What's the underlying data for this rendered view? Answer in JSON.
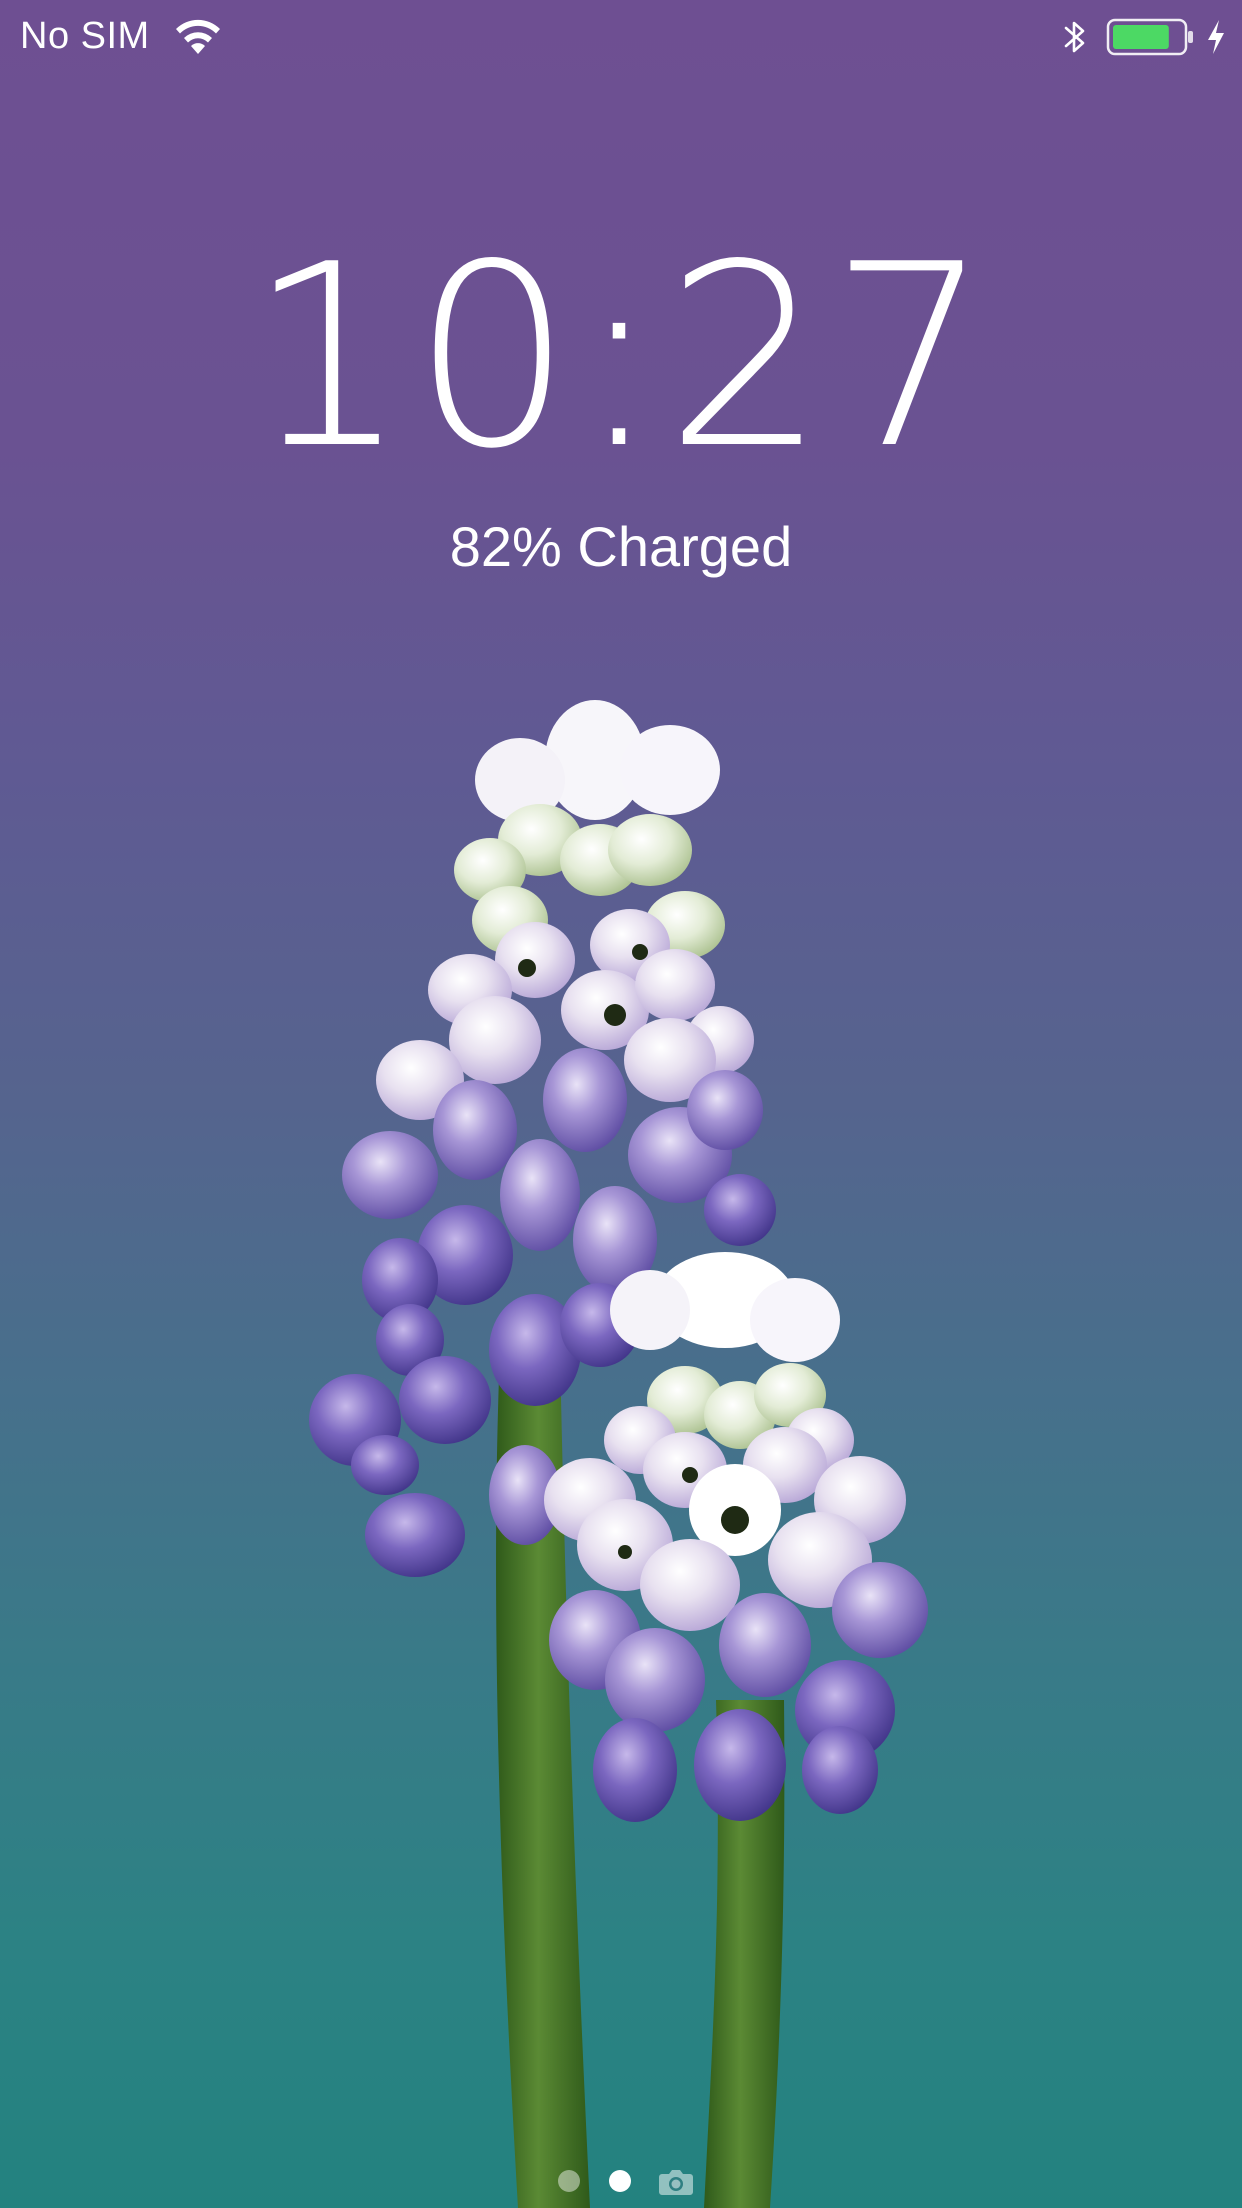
{
  "status_bar": {
    "carrier": "No SIM",
    "icons": [
      "wifi-icon",
      "bluetooth-icon",
      "battery-icon",
      "charging-bolt-icon"
    ],
    "battery_level": 0.82,
    "battery_color": "#4cd964"
  },
  "lock_screen": {
    "time": "10:27",
    "charge_status": "82% Charged"
  },
  "page_indicator": {
    "pages": 2,
    "current_page": 2,
    "icons": [
      "camera-icon"
    ]
  },
  "wallpaper": {
    "subject": "grape-hyacinth-flowers",
    "colors": {
      "top": "#6e4f92",
      "bottom": "#23827f",
      "stem": "#4b7a2c"
    }
  }
}
